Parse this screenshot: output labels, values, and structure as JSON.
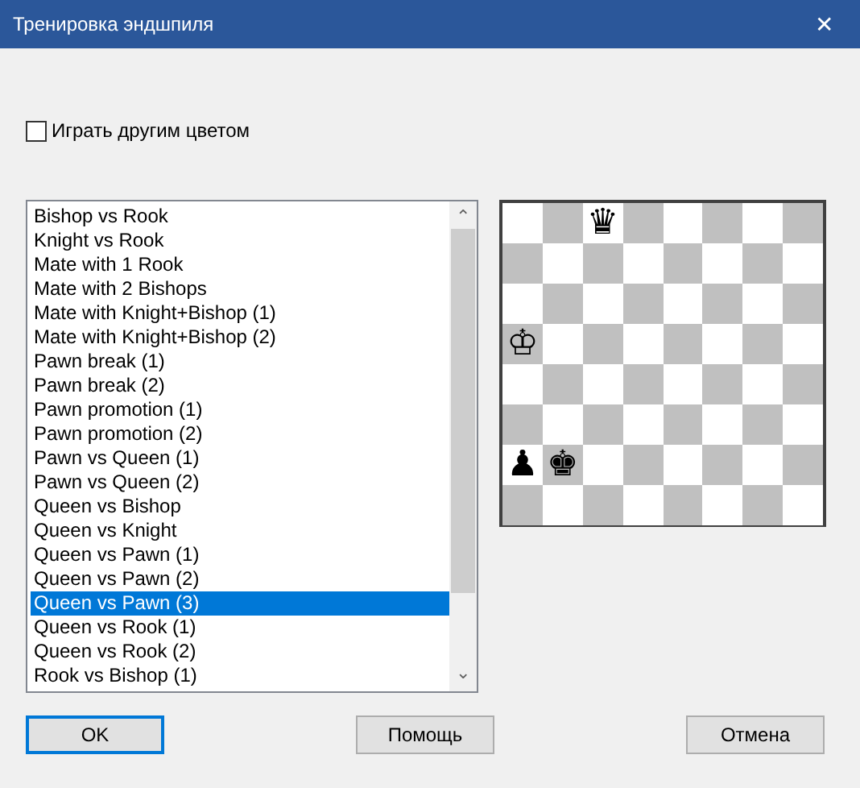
{
  "window": {
    "title": "Тренировка эндшпиля",
    "close": "✕"
  },
  "options": [
    {
      "label": "Играть другим цветом",
      "checked": false
    }
  ],
  "list": {
    "items": [
      {
        "label": "Bishop vs Rook",
        "selected": false
      },
      {
        "label": "Knight vs Rook",
        "selected": false
      },
      {
        "label": "Mate with 1 Rook",
        "selected": false
      },
      {
        "label": "Mate with 2 Bishops",
        "selected": false
      },
      {
        "label": "Mate with Knight+Bishop (1)",
        "selected": false
      },
      {
        "label": "Mate with Knight+Bishop (2)",
        "selected": false
      },
      {
        "label": "Pawn break (1)",
        "selected": false
      },
      {
        "label": "Pawn break (2)",
        "selected": false
      },
      {
        "label": "Pawn promotion (1)",
        "selected": false
      },
      {
        "label": "Pawn promotion (2)",
        "selected": false
      },
      {
        "label": "Pawn vs Queen (1)",
        "selected": false
      },
      {
        "label": "Pawn vs Queen (2)",
        "selected": false
      },
      {
        "label": "Queen vs Bishop",
        "selected": false
      },
      {
        "label": "Queen vs Knight",
        "selected": false
      },
      {
        "label": "Queen vs Pawn (1)",
        "selected": false
      },
      {
        "label": "Queen vs Pawn (2)",
        "selected": false
      },
      {
        "label": "Queen vs Pawn (3)",
        "selected": true
      },
      {
        "label": "Queen vs Rook (1)",
        "selected": false
      },
      {
        "label": "Queen vs Rook (2)",
        "selected": false
      },
      {
        "label": "Rook vs Bishop (1)",
        "selected": false
      }
    ],
    "scroll_up": "⌃",
    "scroll_down": "⌄"
  },
  "board": {
    "ranks": [
      {
        "squares": [
          {
            "kind": "light"
          },
          {
            "kind": "dark"
          },
          {
            "kind": "light",
            "piece": "♛"
          },
          {
            "kind": "dark"
          },
          {
            "kind": "light"
          },
          {
            "kind": "dark"
          },
          {
            "kind": "light"
          },
          {
            "kind": "dark"
          }
        ]
      },
      {
        "squares": [
          {
            "kind": "dark"
          },
          {
            "kind": "light"
          },
          {
            "kind": "dark"
          },
          {
            "kind": "light"
          },
          {
            "kind": "dark"
          },
          {
            "kind": "light"
          },
          {
            "kind": "dark"
          },
          {
            "kind": "light"
          }
        ]
      },
      {
        "squares": [
          {
            "kind": "light"
          },
          {
            "kind": "dark"
          },
          {
            "kind": "light"
          },
          {
            "kind": "dark"
          },
          {
            "kind": "light"
          },
          {
            "kind": "dark"
          },
          {
            "kind": "light"
          },
          {
            "kind": "dark"
          }
        ]
      },
      {
        "squares": [
          {
            "kind": "dark",
            "piece": "♔"
          },
          {
            "kind": "light"
          },
          {
            "kind": "dark"
          },
          {
            "kind": "light"
          },
          {
            "kind": "dark"
          },
          {
            "kind": "light"
          },
          {
            "kind": "dark"
          },
          {
            "kind": "light"
          }
        ]
      },
      {
        "squares": [
          {
            "kind": "light"
          },
          {
            "kind": "dark"
          },
          {
            "kind": "light"
          },
          {
            "kind": "dark"
          },
          {
            "kind": "light"
          },
          {
            "kind": "dark"
          },
          {
            "kind": "light"
          },
          {
            "kind": "dark"
          }
        ]
      },
      {
        "squares": [
          {
            "kind": "dark"
          },
          {
            "kind": "light"
          },
          {
            "kind": "dark"
          },
          {
            "kind": "light"
          },
          {
            "kind": "dark"
          },
          {
            "kind": "light"
          },
          {
            "kind": "dark"
          },
          {
            "kind": "light"
          }
        ]
      },
      {
        "squares": [
          {
            "kind": "light",
            "piece": "♟"
          },
          {
            "kind": "dark",
            "piece": "♚"
          },
          {
            "kind": "light"
          },
          {
            "kind": "dark"
          },
          {
            "kind": "light"
          },
          {
            "kind": "dark"
          },
          {
            "kind": "light"
          },
          {
            "kind": "dark"
          }
        ]
      },
      {
        "squares": [
          {
            "kind": "dark"
          },
          {
            "kind": "light"
          },
          {
            "kind": "dark"
          },
          {
            "kind": "light"
          },
          {
            "kind": "dark"
          },
          {
            "kind": "light"
          },
          {
            "kind": "dark"
          },
          {
            "kind": "light"
          }
        ]
      }
    ]
  },
  "buttons": [
    {
      "label": "OK",
      "default": true
    },
    {
      "label": "Помощь",
      "default": false
    },
    {
      "label": "Отмена",
      "default": false
    }
  ]
}
